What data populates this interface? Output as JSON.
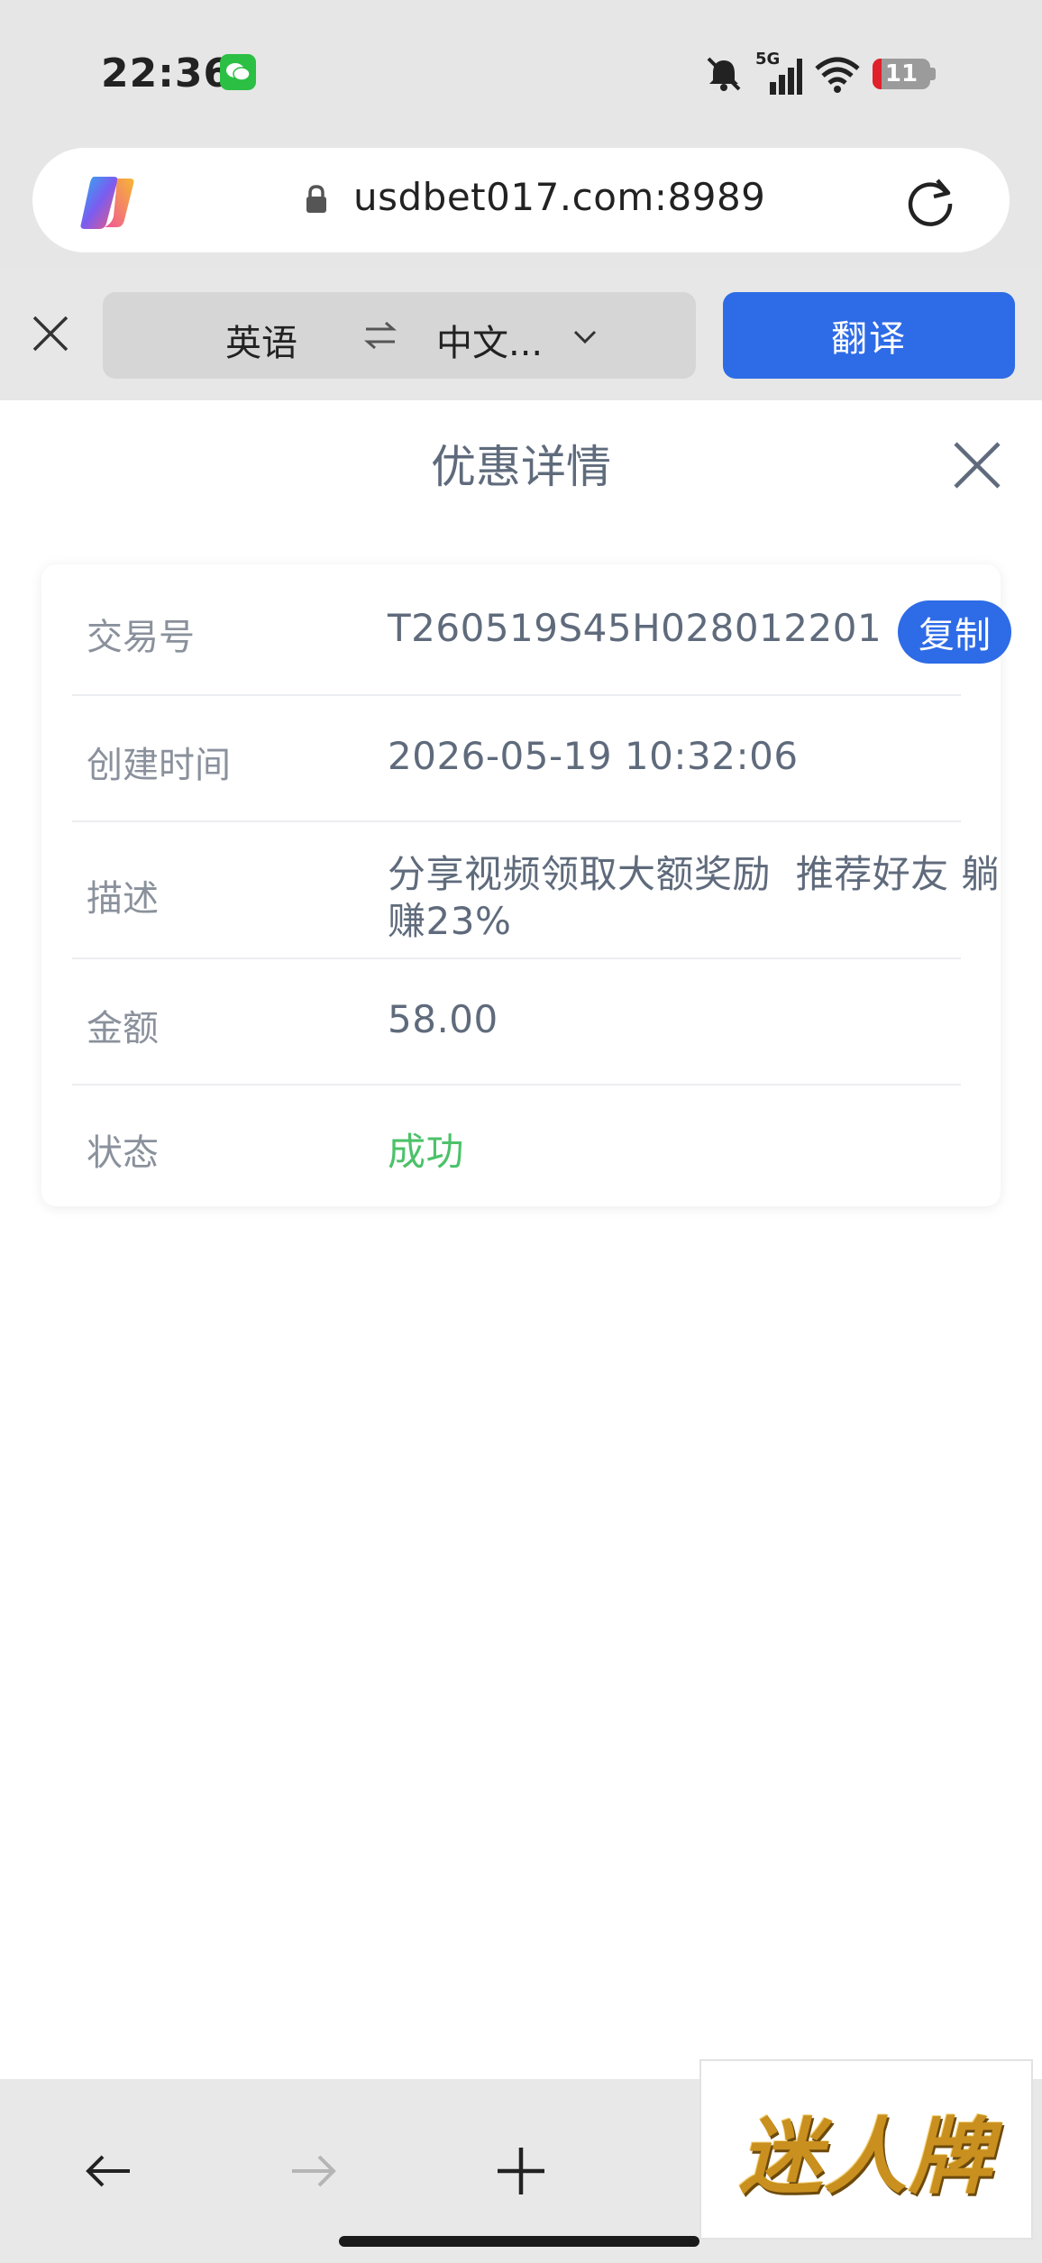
{
  "status_bar": {
    "time": "22:36",
    "network": "5G",
    "battery": "11"
  },
  "browser": {
    "url": "usdbet017.com:8989"
  },
  "translate_bar": {
    "source_lang": "英语",
    "target_lang": "中文...",
    "translate_label": "翻译"
  },
  "page": {
    "title": "优惠详情"
  },
  "details": {
    "copy_label": "复制",
    "rows": [
      {
        "label": "交易号",
        "value": "T260519S45H028012201"
      },
      {
        "label": "创建时间",
        "value": "2026-05-19 10:32:06"
      },
      {
        "label": "描述",
        "value_line1": "分享视频领取大额奖励  推荐好友 躺",
        "value_line2": "赚23%"
      },
      {
        "label": "金额",
        "value": "58.00"
      },
      {
        "label": "状态",
        "value": "成功"
      }
    ]
  },
  "brand": {
    "logo_text": "迷人牌"
  },
  "colors": {
    "accent": "#2e6be6",
    "success": "#4cc26a",
    "value_text": "#5f6b7c",
    "label_text": "#8a919c"
  }
}
